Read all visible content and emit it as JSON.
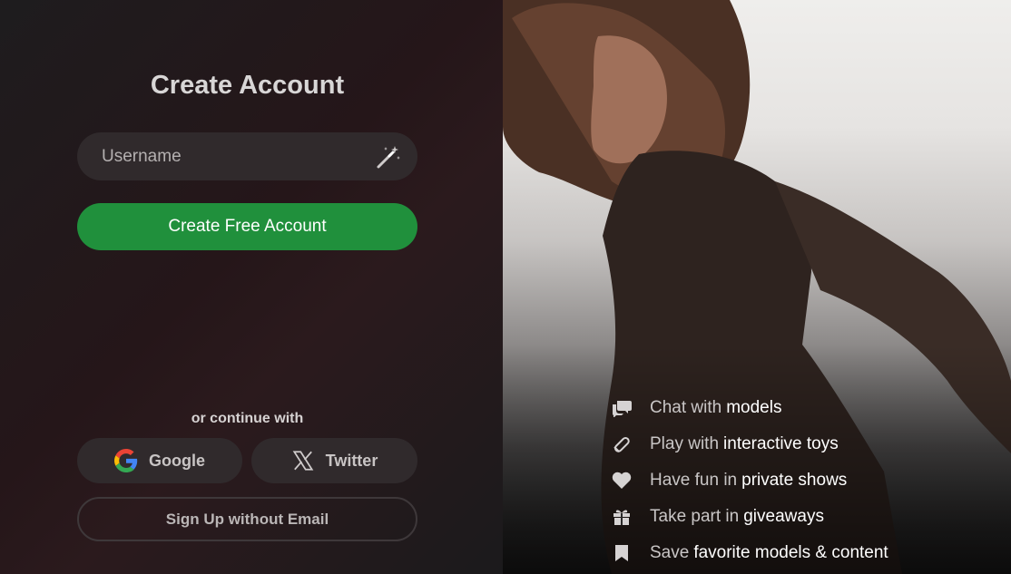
{
  "form": {
    "title": "Create Account",
    "username_placeholder": "Username",
    "create_button": "Create Free Account",
    "or_continue": "or continue with",
    "google_label": "Google",
    "twitter_label": "Twitter",
    "signup_no_email": "Sign Up without Email"
  },
  "features": [
    {
      "icon": "chat-icon",
      "text": "Chat with",
      "highlight": "models"
    },
    {
      "icon": "toy-icon",
      "text": "Play with",
      "highlight": "interactive toys"
    },
    {
      "icon": "heart-icon",
      "text": "Have fun in",
      "highlight": "private shows"
    },
    {
      "icon": "gift-icon",
      "text": "Take part in",
      "highlight": "giveaways"
    },
    {
      "icon": "bookmark-icon",
      "text": "Save",
      "highlight": "favorite models & content"
    }
  ],
  "colors": {
    "primary_green": "#20903c",
    "field_bg": "#302a2c"
  }
}
